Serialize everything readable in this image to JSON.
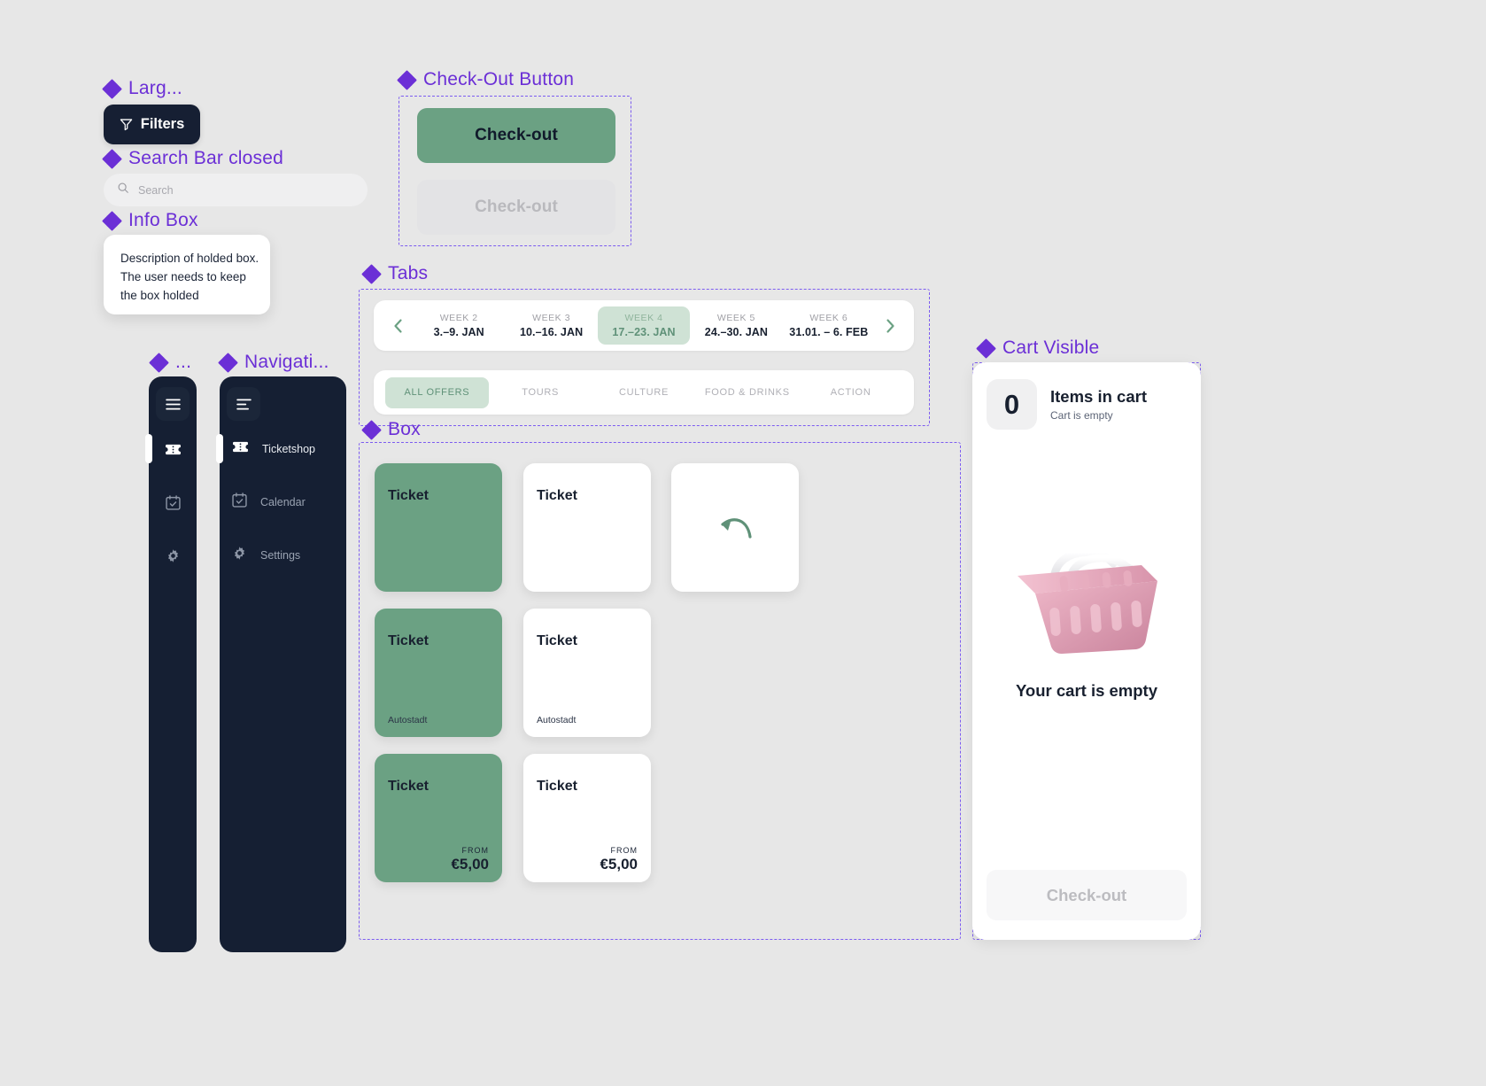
{
  "annotations": {
    "large": "Larg...",
    "search_bar": "Search Bar closed",
    "info_box": "Info Box",
    "checkout_button": "Check-Out Button",
    "tabs": "Tabs",
    "box": "Box",
    "sidebar_collapsed": "...",
    "navigation": "Navigati...",
    "cart_visible": "Cart Visible"
  },
  "filters": {
    "label": "Filters",
    "icon": "filter-icon"
  },
  "search": {
    "placeholder": "Search",
    "value": "",
    "icon": "search-icon"
  },
  "info_box": {
    "text": "Description of holded box. The user needs to keep the box holded"
  },
  "checkout": {
    "primary_label": "Check-out",
    "disabled_label": "Check-out"
  },
  "weeks": {
    "prev_icon": "chevron-left-icon",
    "next_icon": "chevron-right-icon",
    "items": [
      {
        "name": "WEEK 2",
        "range": "3.–9. JAN",
        "active": false
      },
      {
        "name": "WEEK 3",
        "range": "10.–16. JAN",
        "active": false
      },
      {
        "name": "WEEK 4",
        "range": "17.–23. JAN",
        "active": true
      },
      {
        "name": "WEEK 5",
        "range": "24.–30. JAN",
        "active": false
      },
      {
        "name": "WEEK 6",
        "range": "31.01. – 6. FEB",
        "active": false
      }
    ]
  },
  "categories": [
    {
      "label": "ALL OFFERS",
      "active": true
    },
    {
      "label": "TOURS",
      "active": false
    },
    {
      "label": "CULTURE",
      "active": false
    },
    {
      "label": "FOOD & DRINKS",
      "active": false
    },
    {
      "label": "ACTION",
      "active": false
    }
  ],
  "tickets": [
    {
      "title": "Ticket",
      "variant": "green",
      "sub": "",
      "from": "",
      "price": ""
    },
    {
      "title": "Ticket",
      "variant": "white",
      "sub": "",
      "from": "",
      "price": ""
    },
    {
      "title": "",
      "variant": "white",
      "sub": "",
      "from": "",
      "price": "",
      "icon": "undo-arrow-icon"
    },
    {
      "title": "Ticket",
      "variant": "green",
      "sub": "Autostadt",
      "from": "",
      "price": ""
    },
    {
      "title": "Ticket",
      "variant": "white",
      "sub": "Autostadt",
      "from": "",
      "price": ""
    },
    {
      "title": "Ticket",
      "variant": "green",
      "sub": "",
      "from": "FROM",
      "price": "€5,00"
    },
    {
      "title": "Ticket",
      "variant": "white",
      "sub": "",
      "from": "FROM",
      "price": "€5,00"
    }
  ],
  "sidebar": {
    "toggle_collapsed_icon": "hamburger-icon",
    "toggle_expanded_icon": "menu-collapse-icon",
    "items": [
      {
        "label": "Ticketshop",
        "icon": "ticket-icon",
        "active": true
      },
      {
        "label": "Calendar",
        "icon": "calendar-icon",
        "active": false
      },
      {
        "label": "Settings",
        "icon": "gear-icon",
        "active": false
      }
    ]
  },
  "cart": {
    "count": "0",
    "title": "Items in cart",
    "subtitle": "Cart is empty",
    "empty_text": "Your cart is empty",
    "basket_icon": "shopping-basket-illustration",
    "checkout_label": "Check-out"
  },
  "colors": {
    "accent_purple": "#6b2fd6",
    "green": "#6ba183",
    "green_light": "#cfe2d5",
    "navy": "#151f33",
    "bg": "#e7e7e7"
  }
}
